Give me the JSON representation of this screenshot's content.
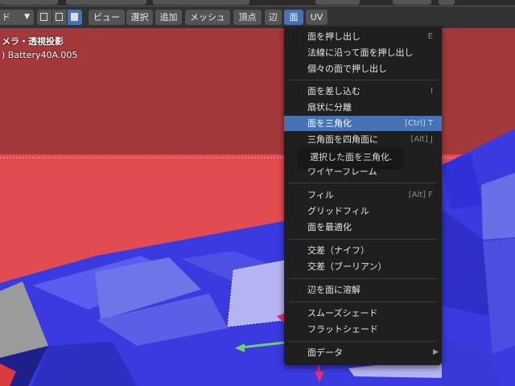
{
  "header": {
    "mode_label": "ド",
    "menus": [
      {
        "label": "ビュー",
        "active": false
      },
      {
        "label": "選択",
        "active": false
      },
      {
        "label": "追加",
        "active": false
      },
      {
        "label": "メッシュ",
        "active": false
      },
      {
        "label": "頂点",
        "active": false
      },
      {
        "label": "辺",
        "active": false
      },
      {
        "label": "面",
        "active": true
      },
      {
        "label": "UV",
        "active": false
      }
    ]
  },
  "viewport": {
    "view_name": "メラ・透視投影",
    "object_name": ") Battery40A.005"
  },
  "face_menu": {
    "items": [
      {
        "label": "面を押し出し",
        "shortcut": "E"
      },
      {
        "label": "法線に沿って面を押し出し",
        "shortcut": ""
      },
      {
        "label": "個々の面で押し出し",
        "shortcut": ""
      },
      {
        "label": "面を差し込む",
        "shortcut": "I"
      },
      {
        "label": "扇状に分離",
        "shortcut": ""
      },
      {
        "label": "面を三角化",
        "shortcut": "[Ctrl] T"
      },
      {
        "label": "三角面を四角面に",
        "shortcut": "[Alt] J"
      },
      {
        "label": "ワイヤーフレーム",
        "shortcut": ""
      },
      {
        "label": "フィル",
        "shortcut": "[Alt] F"
      },
      {
        "label": "グリッドフィル",
        "shortcut": ""
      },
      {
        "label": "面を最適化",
        "shortcut": ""
      },
      {
        "label": "交差（ナイフ）",
        "shortcut": ""
      },
      {
        "label": "交差（ブーリアン）",
        "shortcut": ""
      },
      {
        "label": "辺を面に溶解",
        "shortcut": ""
      },
      {
        "label": "スムーズシェード",
        "shortcut": ""
      },
      {
        "label": "フラットシェード",
        "shortcut": ""
      },
      {
        "label": "面データ",
        "shortcut": ""
      }
    ],
    "highlighted_index": 5
  },
  "tooltip": {
    "text": "選択した面を三角化."
  },
  "colors": {
    "accent": "#4772b3",
    "mesh_blue": "#3a3ae0",
    "mesh_light_blue": "#6f74e6",
    "mesh_red": "#e24b4f",
    "background_dark_red": "#a5383b",
    "gizmo_green": "#6fd06a",
    "gizmo_magenta": "#e0307a"
  }
}
